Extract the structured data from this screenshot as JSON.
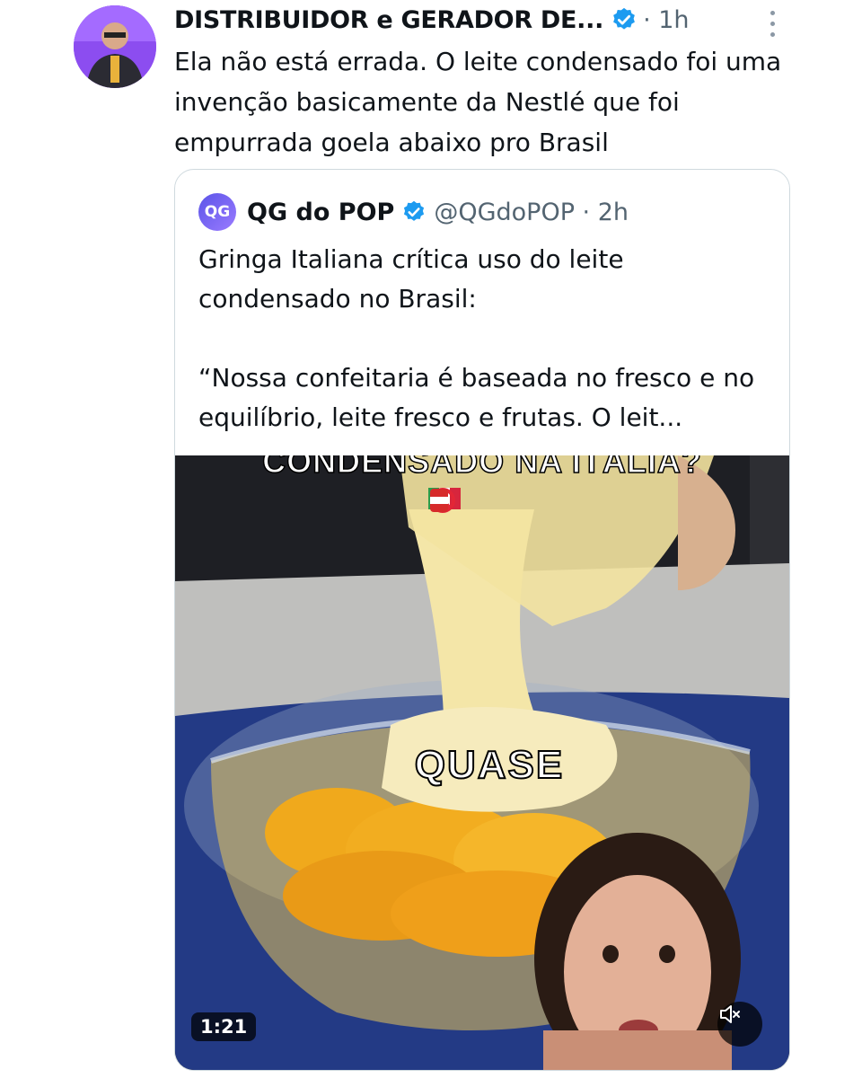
{
  "post": {
    "author_name": "DISTRIBUIDOR e GERADOR DE...",
    "time": "· 1h",
    "text": "Ela não está errada. O leite condensado foi uma invenção basicamente da Nestlé que foi empurrada goela abaixo pro Brasil"
  },
  "quote": {
    "avatar_text": "QG",
    "author_name": "QG do POP",
    "handle_time": "@QGdoPOP · 2h",
    "text": "Gringa Italiana crítica uso do leite condensado no Brasil:\n\n“Nossa confeitaria é baseada no fresco e no equilíbrio, leite fresco e frutas. O leit...",
    "media": {
      "overlay_top": "CONDENSADO NA ITÁLIA?",
      "overlay_mid": "QUASE",
      "duration": "1:21"
    }
  },
  "icons": {
    "verified": "verified-badge-icon",
    "more": "more-options-icon",
    "mute": "volume-muted-icon"
  },
  "colors": {
    "verified_blue": "#1d9bf0",
    "secondary_text": "#536471",
    "border": "#cfd9de"
  }
}
